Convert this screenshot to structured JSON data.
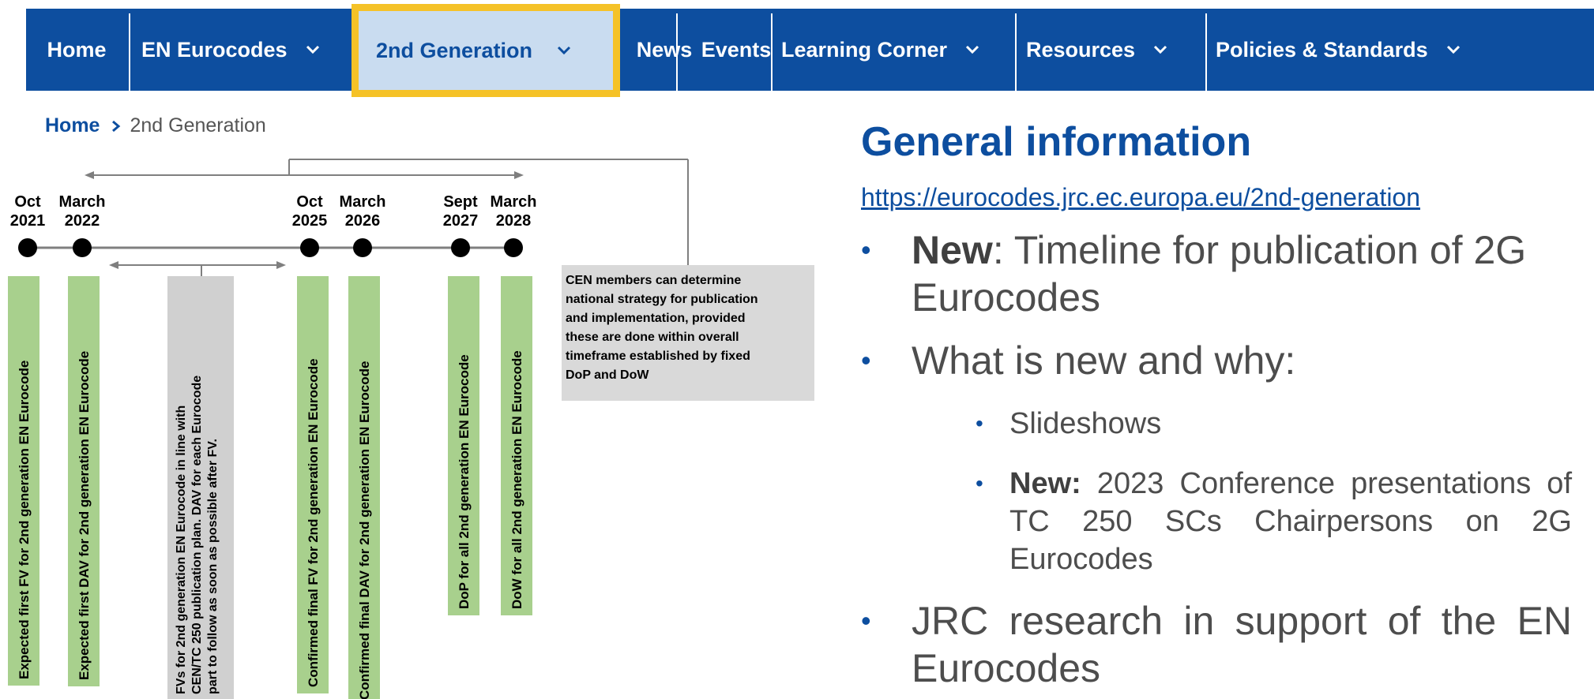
{
  "nav": {
    "home": "Home",
    "eurocodes": "EN Eurocodes",
    "gen2": "2nd Generation",
    "news": "News",
    "events": "Events",
    "learning": "Learning Corner",
    "resources": "Resources",
    "policies": "Policies & Standards"
  },
  "breadcrumb": {
    "home": "Home",
    "current": "2nd Generation"
  },
  "timeline": {
    "dates": [
      {
        "month": "Oct",
        "year": "2021"
      },
      {
        "month": "March",
        "year": "2022"
      },
      {
        "month": "Oct",
        "year": "2025"
      },
      {
        "month": "March",
        "year": "2026"
      },
      {
        "month": "Sept",
        "year": "2027"
      },
      {
        "month": "March",
        "year": "2028"
      }
    ],
    "bars": [
      "Expected first FV for 2nd generation EN Eurocode",
      "Expected first DAV for 2nd generation EN Eurocode",
      "Confirmed final FV for 2nd generation EN Eurocode",
      "Confirmed final DAV for 2nd generation EN Eurocode",
      "DoP for all 2nd generation EN Eurocode",
      "DoW for all 2nd generation EN Eurocode"
    ],
    "grey_bar_lines": [
      "FVs  for 2nd generation EN Eurocode in line with",
      "CEN/TC 250 publication plan. DAV for each Eurocode",
      "part to follow as soon as possible after FV."
    ],
    "note_lines": [
      "CEN members can determine",
      "national strategy for publication",
      "and implementation, provided",
      "these are done within overall",
      "timeframe established by fixed",
      "DoP and DoW"
    ]
  },
  "info": {
    "title": "General information",
    "url": "https://eurocodes.jrc.ec.europa.eu/2nd-generation",
    "b1_bold": "New",
    "b1_text": ": Timeline for publication of 2G Eurocodes",
    "b2_text": "What is new and why:",
    "s1": "Slideshows",
    "s2_bold": "New:",
    "s2_text": " 2023 Conference presentations of TC 250 SCs Chairpersons on 2G Eurocodes",
    "b3_text": "JRC research in support of the EN Eurocodes"
  },
  "colors": {
    "nav_bg": "#0d4e9f",
    "highlight": "#f5c227",
    "green_bar": "#a8d08d",
    "grey_bar": "#d0d0d0"
  }
}
